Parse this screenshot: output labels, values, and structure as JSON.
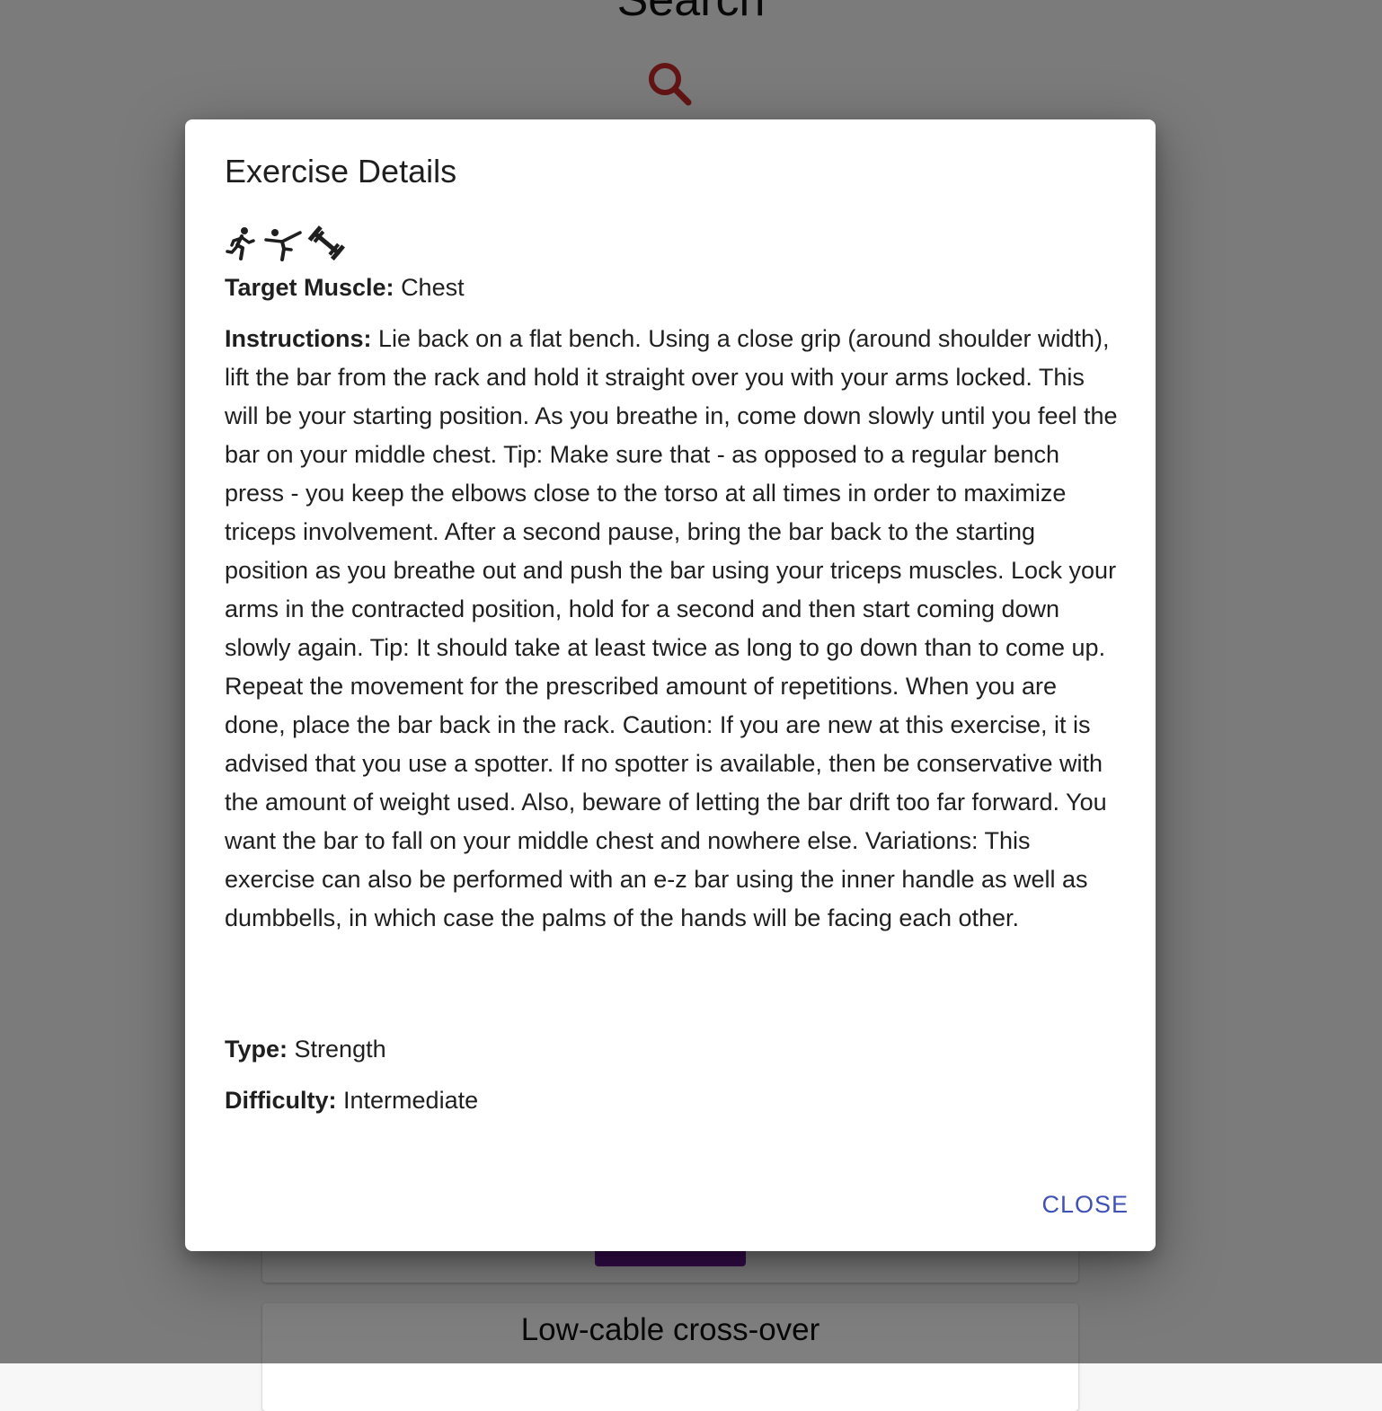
{
  "page": {
    "title": "Search",
    "search_icon": "search-icon"
  },
  "background_cards": [
    {
      "title": ""
    },
    {
      "title": "Low-cable cross-over"
    }
  ],
  "dialog": {
    "title": "Exercise Details",
    "icons": [
      "running-person-icon",
      "martial-arts-icon",
      "dumbbell-icon"
    ],
    "target_label": "Target Muscle:",
    "target_value": "Chest",
    "instructions_label": "Instructions:",
    "instructions_value": "Lie back on a flat bench. Using a close grip (around shoulder width), lift the bar from the rack and hold it straight over you with your arms locked. This will be your starting position. As you breathe in, come down slowly until you feel the bar on your middle chest. Tip: Make sure that - as opposed to a regular bench press - you keep the elbows close to the torso at all times in order to maximize triceps involvement. After a second pause, bring the bar back to the starting position as you breathe out and push the bar using your triceps muscles. Lock your arms in the contracted position, hold for a second and then start coming down slowly again. Tip: It should take at least twice as long to go down than to come up. Repeat the movement for the prescribed amount of repetitions. When you are done, place the bar back in the rack. Caution: If you are new at this exercise, it is advised that you use a spotter. If no spotter is available, then be conservative with the amount of weight used. Also, beware of letting the bar drift too far forward. You want the bar to fall on your middle chest and nowhere else. Variations: This exercise can also be performed with an e-z bar using the inner handle as well as dumbbells, in which case the palms of the hands will be facing each other.",
    "type_label": "Type:",
    "type_value": "Strength",
    "difficulty_label": "Difficulty:",
    "difficulty_value": "Intermediate",
    "close_label": "CLOSE"
  },
  "colors": {
    "accent_link": "#3f51b5",
    "search_icon": "#c62828",
    "card_button": "#6a1b9a"
  }
}
